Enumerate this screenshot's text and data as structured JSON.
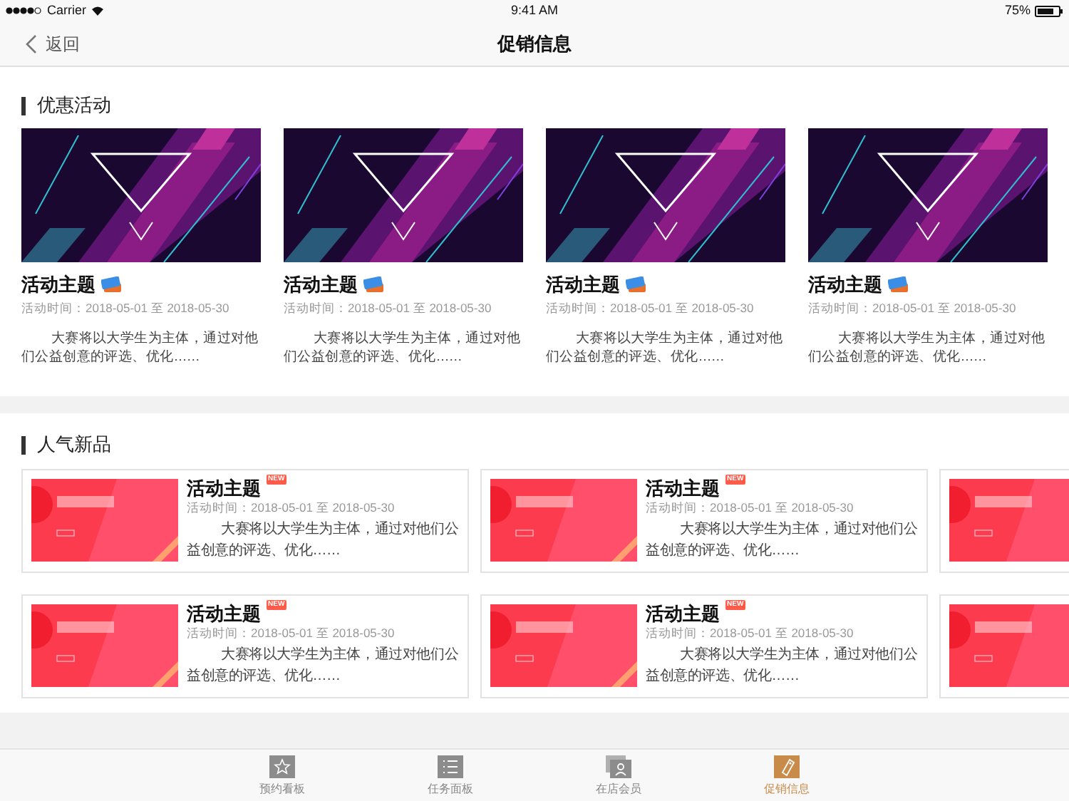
{
  "status_bar": {
    "carrier": "Carrier",
    "time": "9:41 AM",
    "battery": "75%"
  },
  "nav": {
    "back": "返回",
    "title": "促销信息"
  },
  "promotions": {
    "title": "优惠活动",
    "items": [
      {
        "kind": "picture",
        "title": "活动主题",
        "date": "活动时间：2018-05-01 至 2018-05-30",
        "description": "大赛将以大学生为主体，通过对他们公益创意的评选、优化……"
      },
      {
        "kind": "picture",
        "title": "活动主题",
        "date": "活动时间：2018-05-01 至 2018-05-30",
        "description": "大赛将以大学生为主体，通过对他们公益创意的评选、优化……"
      },
      {
        "kind": "picture",
        "title": "活动主题",
        "date": "活动时间：2018-05-01 至 2018-05-30",
        "description": "大赛将以大学生为主体，通过对他们公益创意的评选、优化……"
      },
      {
        "kind": "picture",
        "title": "活动主题",
        "date": "活动时间：2018-05-01 至 2018-05-30",
        "description": "大赛将以大学生为主体，通过对他们公益创意的评选、优化……"
      }
    ]
  },
  "new_products": {
    "title": "人气新品",
    "rows": [
      {
        "items": [
          {
            "kind": "full",
            "badge": "NEW",
            "title": "活动主题",
            "date": "活动时间：2018-05-01 至 2018-05-30",
            "description": "大赛将以大学生为主体，通过对他们公益创意的评选、优化……"
          },
          {
            "kind": "full",
            "badge": "NEW",
            "title": "活动主题",
            "date": "活动时间：2018-05-01 至 2018-05-30",
            "description": "大赛将以大学生为主体，通过对他们公益创意的评选、优化……"
          },
          {
            "kind": "clipped"
          }
        ]
      },
      {
        "items": [
          {
            "kind": "full",
            "badge": "NEW",
            "title": "活动主题",
            "date": "活动时间：2018-05-01 至 2018-05-30",
            "description": "大赛将以大学生为主体，通过对他们公益创意的评选、优化……"
          },
          {
            "kind": "full",
            "badge": "NEW",
            "title": "活动主题",
            "date": "活动时间：2018-05-01 至 2018-05-30",
            "description": "大赛将以大学生为主体，通过对他们公益创意的评选、优化……"
          },
          {
            "kind": "clipped"
          }
        ]
      }
    ]
  },
  "tab_bar": [
    {
      "label": "预约看板",
      "kind": "star",
      "selected": false
    },
    {
      "label": "任务面板",
      "kind": "list",
      "selected": false
    },
    {
      "label": "在店会员",
      "kind": "member",
      "selected": false
    },
    {
      "label": "促销信息",
      "kind": "tag",
      "selected": true
    }
  ]
}
